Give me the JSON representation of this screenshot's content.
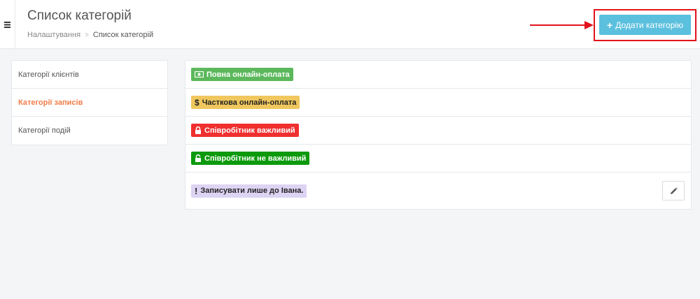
{
  "header": {
    "title": "Список категорій",
    "breadcrumb": {
      "parent": "Налаштування",
      "separator": ">",
      "current": "Список категорій"
    },
    "add_button": {
      "icon": "plus-icon",
      "label": "Додати категорію"
    }
  },
  "sidebar": {
    "items": [
      {
        "label": "Категорії клієнтів",
        "active": false
      },
      {
        "label": "Категорії записів",
        "active": true
      },
      {
        "label": "Категорії подій",
        "active": false
      }
    ]
  },
  "categories": [
    {
      "label": "Повна онлайн-оплата",
      "icon": "money-bill-icon",
      "color": "#5cb85c",
      "text_color": "#ffffff"
    },
    {
      "label": "Часткова онлайн-оплата",
      "icon": "dollar-icon",
      "color": "#f0c75e",
      "text_color": "#222222"
    },
    {
      "label": "Співробітник важливий",
      "icon": "lock-icon",
      "color": "#f02f2f",
      "text_color": "#ffffff"
    },
    {
      "label": "Співробітник не важливий",
      "icon": "unlock-icon",
      "color": "#0c9a0c",
      "text_color": "#ffffff"
    },
    {
      "label": "Записувати лише до Івана.",
      "icon": "exclamation-icon",
      "color": "#ddd4f3",
      "text_color": "#222222"
    }
  ],
  "colors": {
    "accent": "#f07d47",
    "button": "#5bc0de",
    "annotation": "#e2131b"
  }
}
